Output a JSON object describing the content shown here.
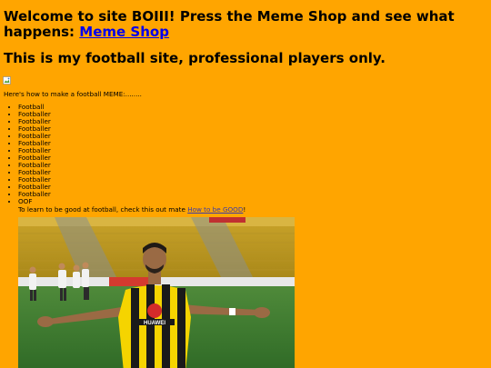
{
  "header": {
    "welcome_text": "Welcome to site BOIII! Press the Meme Shop and see what happens:",
    "meme_shop_link": "Meme Shop",
    "subtitle": "This is my football site, professional players only."
  },
  "intro": {
    "text": "Here's how to make a football MEME:........"
  },
  "ingredients": [
    "Football",
    "Footballer",
    "Footballer",
    "Footballer",
    "Footballer",
    "Footballer",
    "Footballer",
    "Footballer",
    "Footballer",
    "Footballer",
    "Footballer",
    "Footballer",
    "Footballer",
    "OOF"
  ],
  "tip": {
    "before": "To learn to be good at football, check this out mate ",
    "link": "How to be GOOD",
    "after": "!"
  },
  "photo": {
    "sponsor_text": "HUAWEI"
  },
  "colors": {
    "background": "#ffa500",
    "link": "#0000ee",
    "visited_link": "#3a3aa8"
  }
}
